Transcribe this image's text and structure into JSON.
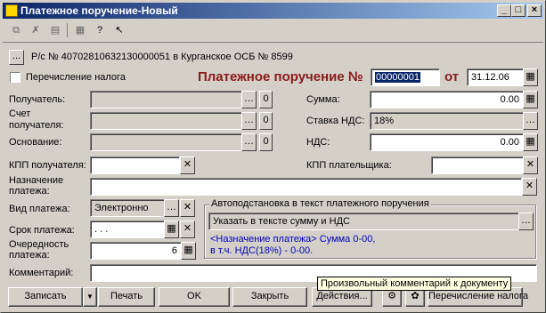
{
  "window": {
    "title": "Платежное поручение-Новый",
    "minimize": "_",
    "maximize": "□",
    "close": "×"
  },
  "toolbar": {
    "icons": [
      "copy-icon",
      "delete-icon",
      "doc-icon",
      "list-icon",
      "help-icon",
      "pointer-help-icon"
    ]
  },
  "account": {
    "button": "...",
    "text": "Р/с № 40702810632130000051 в Курганское ОСБ № 8599"
  },
  "tax_transfer": {
    "label": "Перечисление налога"
  },
  "doc": {
    "title": "Платежное поручение №",
    "number": "00000001",
    "from_label": "от",
    "date": "31.12.06"
  },
  "left": {
    "recipient_label": "Получатель:",
    "recipient_account_label": "Счет\nполучателя:",
    "basis_label": "Основание:",
    "recipient_kpp_label": "КПП получателя:",
    "purpose_label": "Назначение\nплатежа:",
    "payment_type_label": "Вид платежа:",
    "payment_type_value": "Электронно",
    "due_label": "Срок платежа:",
    "due_value": ". . .",
    "priority_label": "Очередность\nплатежа:",
    "priority_value": "6",
    "comment_label": "Комментарий:",
    "zero": "0"
  },
  "right": {
    "sum_label": "Сумма:",
    "sum_value": "0.00",
    "vat_rate_label": "Ставка НДС:",
    "vat_rate_value": "18%",
    "vat_label": "НДС:",
    "vat_value": "0.00",
    "payer_kpp_label": "КПП плательщика:"
  },
  "autofill": {
    "group_title": "Автоподстановка в текст платежного поручения",
    "select_value": "Указать в тексте сумму и НДС",
    "preview_line1": "<Назначение платежа> Сумма 0-00,",
    "preview_line2": "в т.ч. НДС(18%) - 0-00."
  },
  "tooltip": "Произвольный комментарий к документу",
  "buttons": {
    "save": "Записать",
    "print": "Печать",
    "ok": "OK",
    "close": "Закрыть",
    "actions": "Действия...",
    "tax_transfer": "Перечисление налога"
  },
  "colors": {
    "title_red": "#8b1a1a",
    "preview_blue": "#0000c0"
  }
}
